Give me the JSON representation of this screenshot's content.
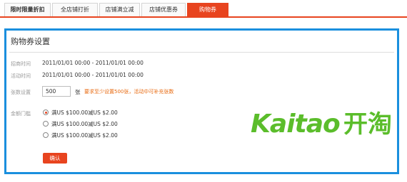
{
  "tabs": [
    {
      "label": "限时限量折扣",
      "active": false
    },
    {
      "label": "全店铺打折",
      "active": false
    },
    {
      "label": "店铺满立减",
      "active": false
    },
    {
      "label": "店铺优惠券",
      "active": false
    },
    {
      "label": "购物券",
      "active": true
    }
  ],
  "panel": {
    "title": "购物券设置",
    "recruit_time": {
      "label": "招商时间",
      "value": "2011/01/01 00:00 - 2011/01/01 00:00"
    },
    "activity_time": {
      "label": "活动时间",
      "value": "2011/01/01 00:00 - 2011/01/01 00:00"
    },
    "quantity": {
      "label": "张数设置",
      "value": "500",
      "unit": "张",
      "hint": "要求至少设置500张，活动中可补充张数"
    },
    "threshold": {
      "label": "金额门槛",
      "options": [
        {
          "label": "满US $100.00减US $2.00",
          "checked": true
        },
        {
          "label": "满US $100.00减US $2.00",
          "checked": false
        },
        {
          "label": "满US $100.00减US $2.00",
          "checked": false
        }
      ]
    },
    "confirm_button": "确认"
  },
  "watermark": {
    "latin": "Kaitao",
    "chinese": "开淘"
  },
  "colors": {
    "accent": "#e8441f",
    "frame": "#1a8fde",
    "hint": "#e86a10",
    "watermark": "#5bbd2b"
  }
}
